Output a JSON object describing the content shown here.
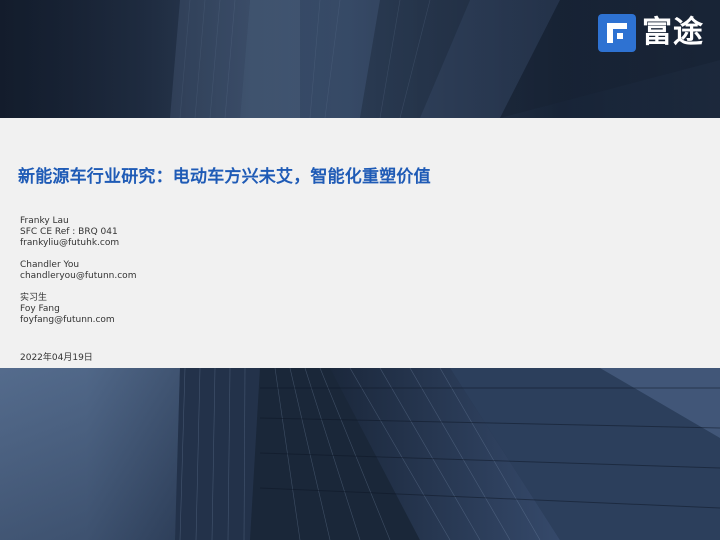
{
  "brand": {
    "logo_text": "富途",
    "accent_color": "#2e72d2"
  },
  "title": "新能源车行业研究：电动车方兴未艾，智能化重塑价值",
  "authors": [
    {
      "name": "Franky Lau",
      "ref": "SFC CE Ref : BRQ 041",
      "email": "frankyliu@futuhk.com"
    },
    {
      "name": "Chandler You",
      "email": "chandleryou@futunn.com"
    },
    {
      "role": "实习生",
      "name": "Foy Fang",
      "email": "foyfang@futunn.com"
    }
  ],
  "date": "2022年04月19日",
  "colors": {
    "title": "#1f5bb6",
    "band_background": "#f1f1f1",
    "text": "#333333"
  }
}
